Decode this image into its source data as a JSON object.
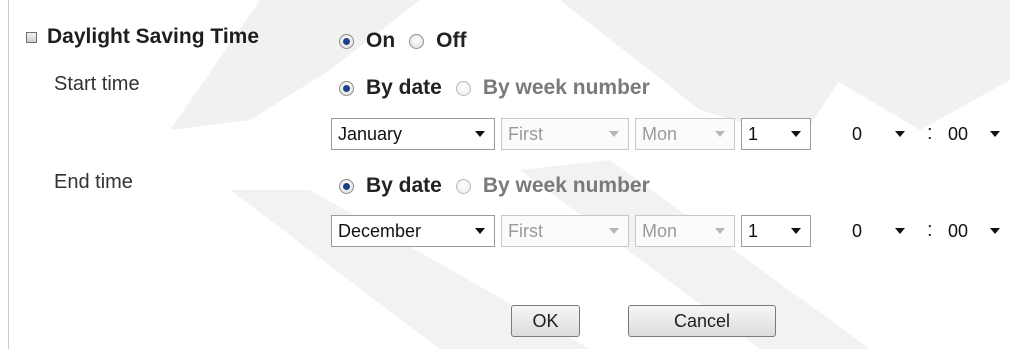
{
  "dst": {
    "title": "Daylight Saving Time",
    "on_label": "On",
    "off_label": "Off",
    "state": "On"
  },
  "start": {
    "label": "Start time",
    "by_date_label": "By date",
    "by_week_label": "By week number",
    "mode": "By date",
    "month": "January",
    "week": "First",
    "weekday": "Mon",
    "day": "1",
    "hour": "0",
    "minute": "00"
  },
  "end": {
    "label": "End time",
    "by_date_label": "By date",
    "by_week_label": "By week number",
    "mode": "By date",
    "month": "December",
    "week": "First",
    "weekday": "Mon",
    "day": "1",
    "hour": "0",
    "minute": "00"
  },
  "time_separator": ":",
  "buttons": {
    "ok": "OK",
    "cancel": "Cancel"
  },
  "colors": {
    "radio_selected": "#1f3f8a",
    "disabled_text": "#9a9a9a",
    "watermark": "#efefef"
  },
  "icons": {
    "section_marker": "square-bullet-icon",
    "dropdown": "caret-down-icon"
  }
}
